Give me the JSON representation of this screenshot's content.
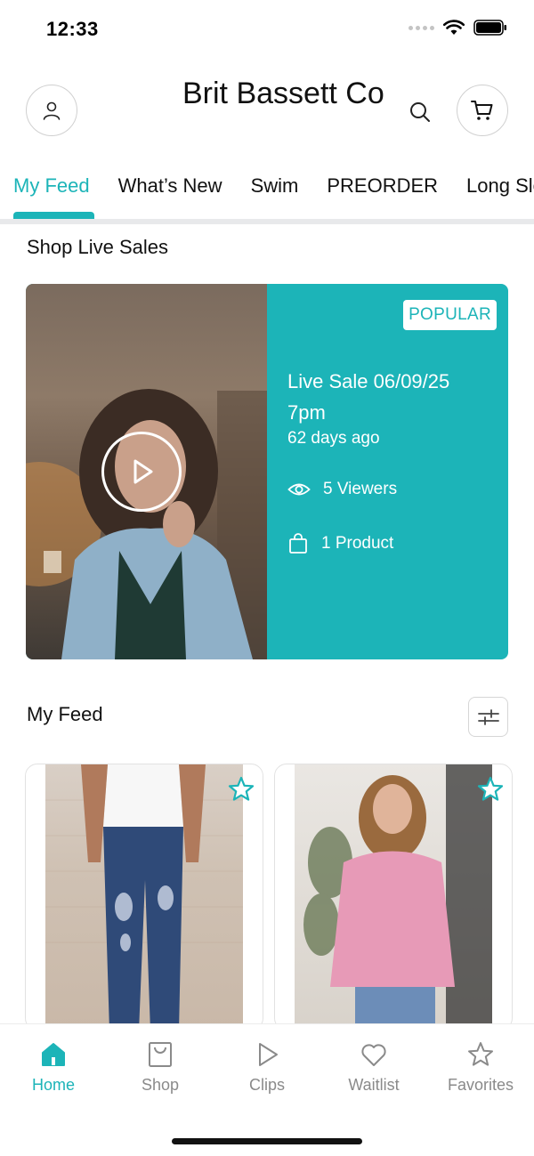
{
  "status_bar": {
    "time": "12:33"
  },
  "header": {
    "brand": "Brit Bassett Co"
  },
  "tabs": [
    {
      "label": "My Feed",
      "active": true
    },
    {
      "label": "What’s New"
    },
    {
      "label": "Swim"
    },
    {
      "label": "PREORDER"
    },
    {
      "label": "Long Sleeve"
    }
  ],
  "live_sales": {
    "title": "Shop Live Sales",
    "card": {
      "badge": "POPULAR",
      "name": "Live Sale 06/09/25 7pm",
      "ago": "62 days ago",
      "viewers": "5 Viewers",
      "products": "1 Product"
    }
  },
  "feed": {
    "title": "My Feed"
  },
  "bottom_nav": [
    {
      "label": "Home",
      "icon": "home-icon",
      "active": true
    },
    {
      "label": "Shop",
      "icon": "shopping-bag-icon"
    },
    {
      "label": "Clips",
      "icon": "play-icon"
    },
    {
      "label": "Waitlist",
      "icon": "heart-icon"
    },
    {
      "label": "Favorites",
      "icon": "star-icon"
    }
  ],
  "colors": {
    "accent": "#1cb4b8",
    "divider": "#e8e9eb"
  }
}
